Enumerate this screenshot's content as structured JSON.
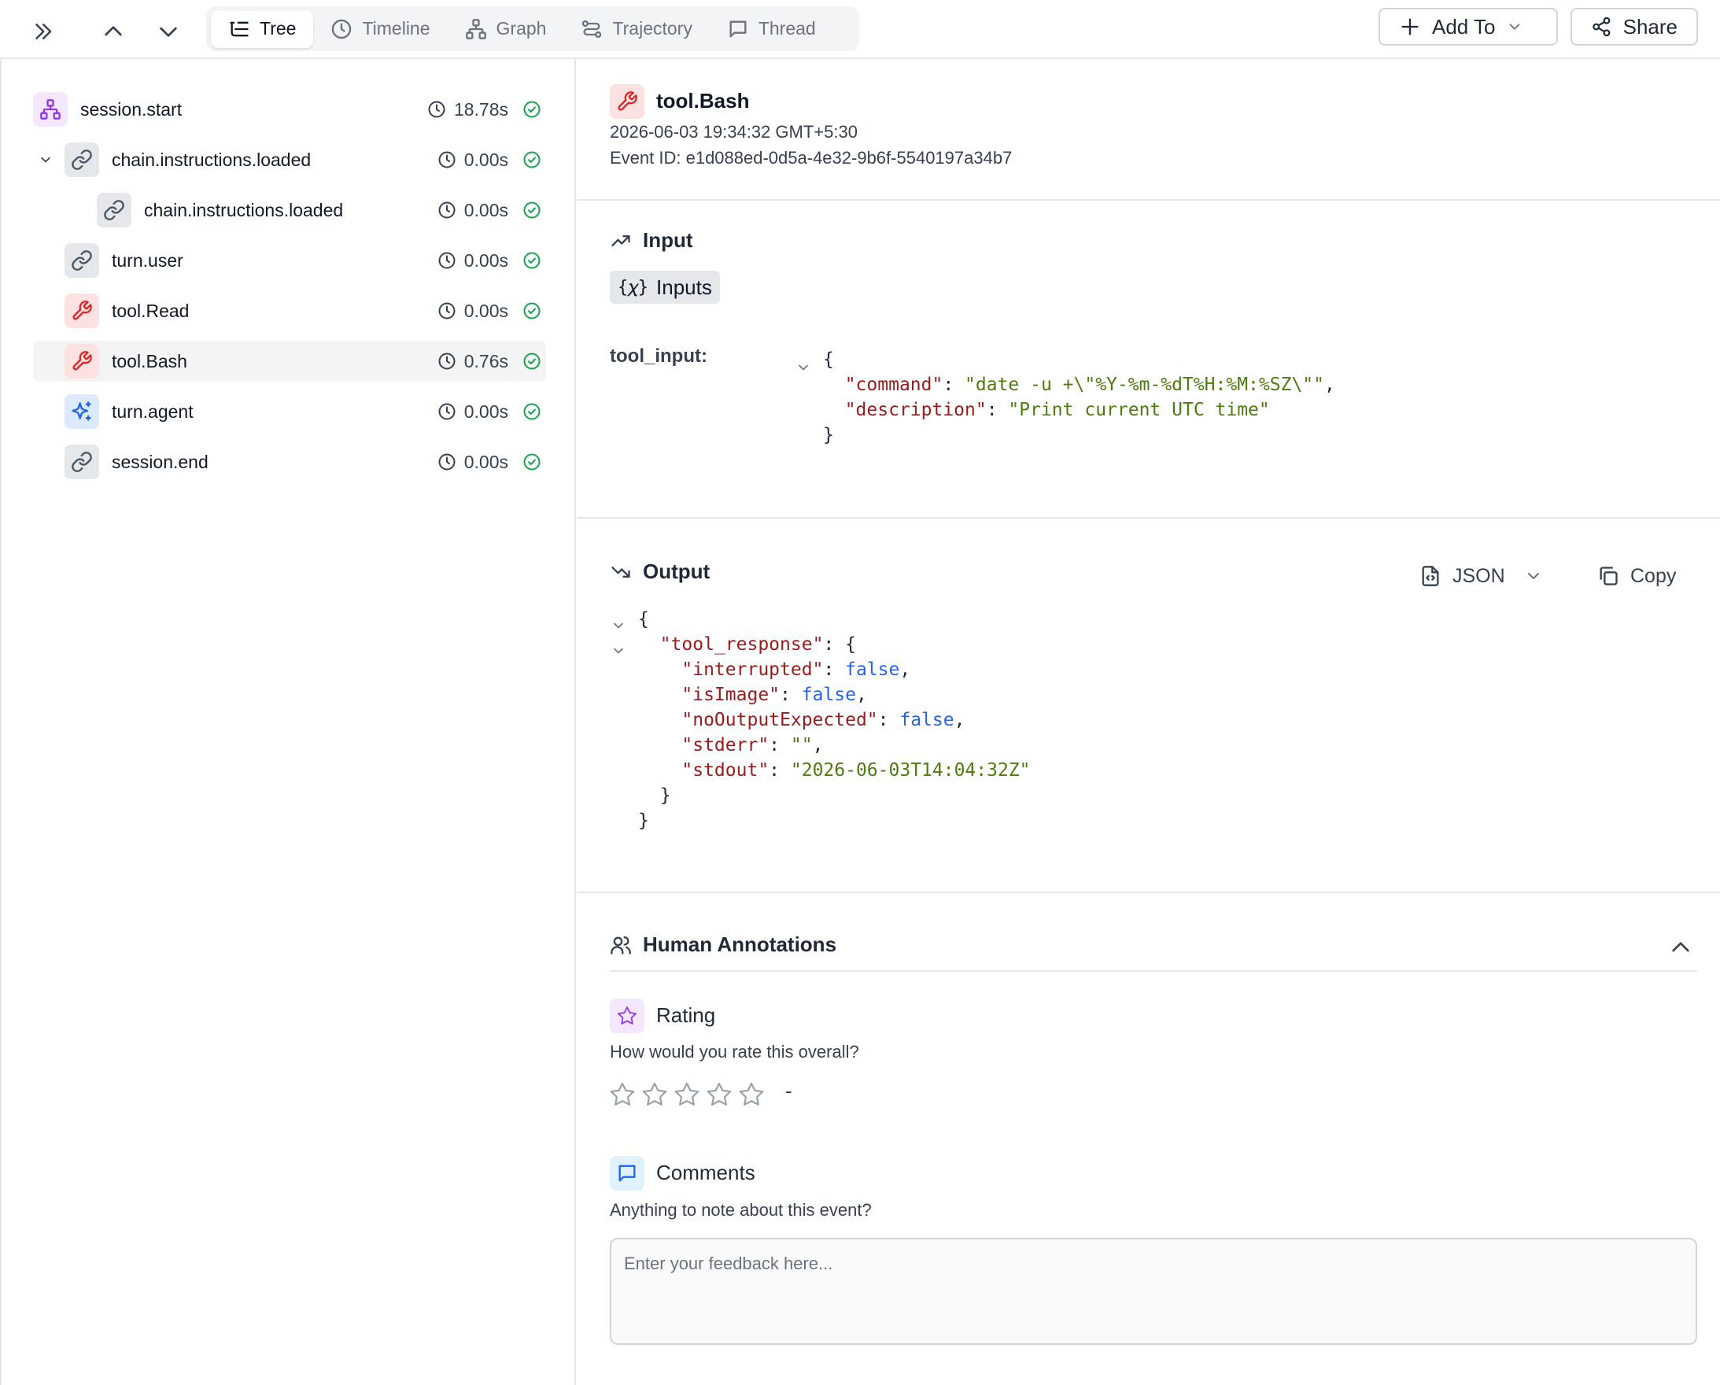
{
  "toolbar": {
    "tabs": [
      {
        "label": "Tree",
        "icon": "list-tree-icon",
        "active": true
      },
      {
        "label": "Timeline",
        "icon": "clock-icon",
        "active": false
      },
      {
        "label": "Graph",
        "icon": "network-icon",
        "active": false
      },
      {
        "label": "Trajectory",
        "icon": "route-icon",
        "active": false
      },
      {
        "label": "Thread",
        "icon": "message-square-icon",
        "active": false
      }
    ],
    "add_to_label": "Add To",
    "share_label": "Share"
  },
  "tree": {
    "items": [
      {
        "name": "session.start",
        "duration": "18.78s",
        "icon": "sitemap-icon",
        "status": "success"
      },
      {
        "name": "chain.instructions.loaded",
        "duration": "0.00s",
        "icon": "link-icon",
        "status": "success",
        "expanded": true
      },
      {
        "name": "chain.instructions.loaded",
        "duration": "0.00s",
        "icon": "link-icon",
        "status": "success"
      },
      {
        "name": "turn.user",
        "duration": "0.00s",
        "icon": "link-icon",
        "status": "success"
      },
      {
        "name": "tool.Read",
        "duration": "0.00s",
        "icon": "wrench-icon",
        "status": "success"
      },
      {
        "name": "tool.Bash",
        "duration": "0.76s",
        "icon": "wrench-icon",
        "status": "success",
        "selected": true
      },
      {
        "name": "turn.agent",
        "duration": "0.00s",
        "icon": "sparkles-icon",
        "status": "success"
      },
      {
        "name": "session.end",
        "duration": "0.00s",
        "icon": "link-icon",
        "status": "success"
      }
    ]
  },
  "event": {
    "title": "tool.Bash",
    "timestamp": "2026-06-03 19:34:32 GMT+5:30",
    "event_id": "Event ID: e1d088ed-0d5a-4e32-9b6f-5540197a34b7"
  },
  "input": {
    "title": "Input",
    "chip_icon": "{𝜒}",
    "chip_label": "Inputs",
    "field_label": "tool_input:",
    "command_key": "\"command\"",
    "command_value": "\"date -u +\\\"%Y-%m-%dT%H:%M:%SZ\\\"\"",
    "description_key": "\"description\"",
    "description_value": "\"Print current UTC time\""
  },
  "output": {
    "title": "Output",
    "format_label": "JSON",
    "copy_label": "Copy",
    "response_key": "\"tool_response\"",
    "fields": [
      {
        "key": "\"interrupted\"",
        "value": "false",
        "type": "bool"
      },
      {
        "key": "\"isImage\"",
        "value": "false",
        "type": "bool"
      },
      {
        "key": "\"noOutputExpected\"",
        "value": "false",
        "type": "bool"
      },
      {
        "key": "\"stderr\"",
        "value": "\"\"",
        "type": "string"
      },
      {
        "key": "\"stdout\"",
        "value": "\"2026-06-03T14:04:32Z\"",
        "type": "string"
      }
    ]
  },
  "annotations": {
    "title": "Human Annotations",
    "rating": {
      "title": "Rating",
      "question": "How would you rate this overall?",
      "value": "-",
      "stars_total": 5,
      "stars_filled": 0
    },
    "comments": {
      "title": "Comments",
      "question": "Anything to note about this event?",
      "placeholder": "Enter your feedback here...",
      "value": ""
    }
  }
}
